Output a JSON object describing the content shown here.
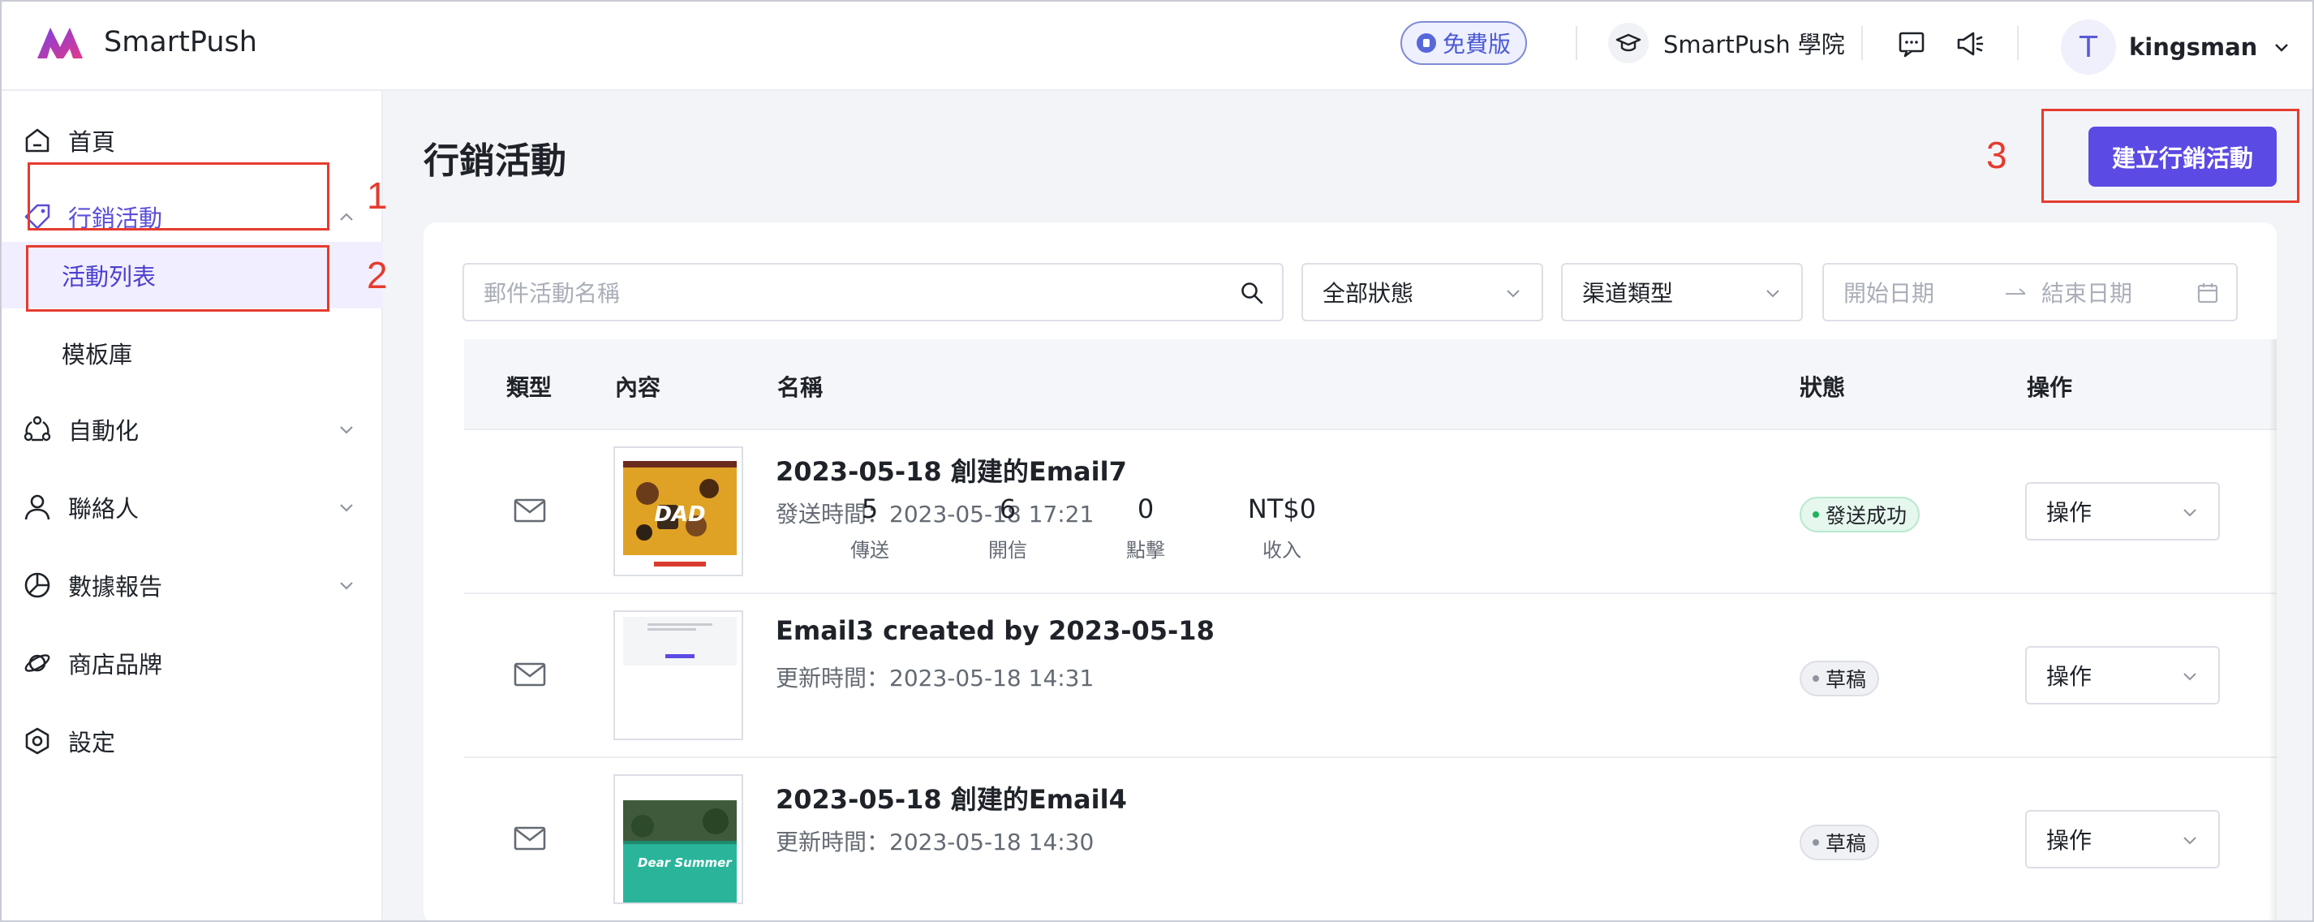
{
  "app": {
    "name": "SmartPush"
  },
  "header": {
    "plan_badge": "免費版",
    "academy": "SmartPush 學院",
    "avatar_initial": "T",
    "username": "kingsman"
  },
  "sidebar": {
    "items": [
      {
        "label": "首頁",
        "icon": "home-icon"
      },
      {
        "label": "行銷活動",
        "icon": "tag-icon"
      },
      {
        "label": "活動列表"
      },
      {
        "label": "模板庫"
      },
      {
        "label": "自動化",
        "icon": "automation-icon"
      },
      {
        "label": "聯絡人",
        "icon": "user-icon"
      },
      {
        "label": "數據報告",
        "icon": "pie-chart-icon"
      },
      {
        "label": "商店品牌",
        "icon": "planet-icon"
      },
      {
        "label": "設定",
        "icon": "settings-icon"
      }
    ]
  },
  "annotations": [
    "1",
    "2",
    "3"
  ],
  "main": {
    "title": "行銷活動",
    "create_button": "建立行銷活動",
    "filters": {
      "search_placeholder": "郵件活動名稱",
      "status": "全部狀態",
      "channel": "渠道類型",
      "start_date": "開始日期",
      "end_date": "結束日期"
    },
    "columns": [
      "類型",
      "內容",
      "名稱",
      "狀態",
      "操作"
    ],
    "rows": [
      {
        "name": "2023-05-18 創建的Email7",
        "time": "發送時間：2023-05-18 17:21",
        "metrics": [
          {
            "value": "5",
            "label": "傳送"
          },
          {
            "value": "6",
            "label": "開信"
          },
          {
            "value": "0",
            "label": "點擊"
          },
          {
            "value": "NT$0",
            "label": "收入"
          }
        ],
        "status": "發送成功",
        "action": "操作",
        "thumb_text": "DAD"
      },
      {
        "name": "Email3 created by 2023-05-18",
        "time": "更新時間：2023-05-18 14:31",
        "status": "草稿",
        "action": "操作"
      },
      {
        "name": "2023-05-18 創建的Email4",
        "time": "更新時間：2023-05-18 14:30",
        "status": "草稿",
        "action": "操作",
        "thumb_text": "Dear Summer We Love You"
      }
    ]
  },
  "colors": {
    "accent": "#5b4ae4",
    "annotation": "#e63b2e"
  }
}
